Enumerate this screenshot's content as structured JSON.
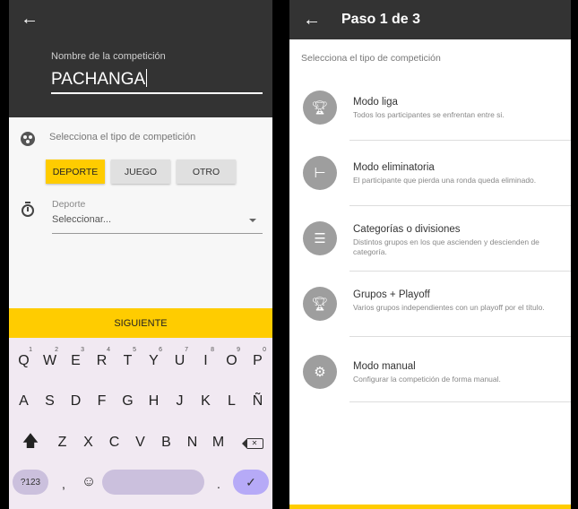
{
  "colors": {
    "header": "#333333",
    "accent": "#ffcc00",
    "keyboard": "#f1e9f2"
  },
  "left": {
    "back_icon": "arrow-left-icon",
    "name_label": "Nombre de la competición",
    "name_value": "PACHANGA",
    "type_label": "Selecciona el tipo de competición",
    "type_chips": [
      {
        "label": "DEPORTE",
        "selected": true
      },
      {
        "label": "JUEGO",
        "selected": false
      },
      {
        "label": "OTRO",
        "selected": false
      }
    ],
    "sport_label": "Deporte",
    "sport_value": "Seleccionar...",
    "next_button": "SIGUIENTE",
    "keyboard": {
      "row1": [
        {
          "key": "Q",
          "hint": "1"
        },
        {
          "key": "W",
          "hint": "2"
        },
        {
          "key": "E",
          "hint": "3"
        },
        {
          "key": "R",
          "hint": "4"
        },
        {
          "key": "T",
          "hint": "5"
        },
        {
          "key": "Y",
          "hint": "6"
        },
        {
          "key": "U",
          "hint": "7"
        },
        {
          "key": "I",
          "hint": "8"
        },
        {
          "key": "O",
          "hint": "9"
        },
        {
          "key": "P",
          "hint": "0"
        }
      ],
      "row2": [
        "A",
        "S",
        "D",
        "F",
        "G",
        "H",
        "J",
        "K",
        "L",
        "Ñ"
      ],
      "row3": [
        "Z",
        "X",
        "C",
        "V",
        "B",
        "N",
        "M"
      ],
      "mode_key": "?123",
      "comma": ",",
      "period": ".",
      "shift_icon": "shift-icon",
      "backspace_icon": "backspace-icon",
      "emoji_icon": "emoji-icon",
      "enter_icon": "check-icon"
    }
  },
  "right": {
    "back_icon": "arrow-left-icon",
    "title": "Paso 1 de 3",
    "subtitle": "Selecciona el tipo de competición",
    "modes": [
      {
        "icon": "trophy-icon",
        "name": "Modo liga",
        "desc": "Todos los participantes se enfrentan entre si."
      },
      {
        "icon": "bracket-icon",
        "name": "Modo eliminatoria",
        "desc": "El participante que pierda una ronda queda eliminado."
      },
      {
        "icon": "list-icon",
        "name": "Categorías o divisiones",
        "desc": "Distintos grupos en los que ascienden y descienden de categoría."
      },
      {
        "icon": "trophy-plus-icon",
        "name": "Grupos + Playoff",
        "desc": "Varios grupos independientes con un playoff por el título."
      },
      {
        "icon": "gear-icon",
        "name": "Modo manual",
        "desc": "Configurar la competición de forma manual."
      }
    ]
  }
}
